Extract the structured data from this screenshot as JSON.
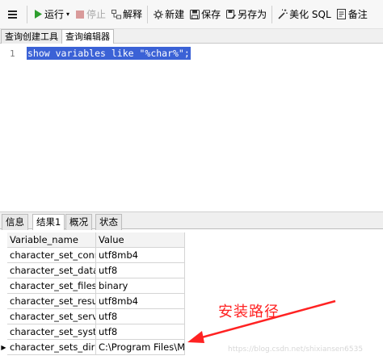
{
  "toolbar": {
    "menu_icon": "hamburger-icon",
    "run_label": "运行",
    "stop_label": "停止",
    "explain_label": "解释",
    "new_label": "新建",
    "save_label": "保存",
    "save_as_label": "另存为",
    "beautify_label": "美化 SQL",
    "notes_label": "备注"
  },
  "editor_tabs": [
    "查询创建工具",
    "查询编辑器"
  ],
  "editor": {
    "line_number": "1",
    "code": "show variables like \"%char%\";"
  },
  "result_tabs": [
    "信息",
    "结果1",
    "概况",
    "状态"
  ],
  "grid": {
    "columns": [
      "Variable_name",
      "Value"
    ],
    "rows": [
      [
        "character_set_conne",
        "utf8mb4"
      ],
      [
        "character_set_databa",
        "utf8"
      ],
      [
        "character_set_filesys",
        "binary"
      ],
      [
        "character_set_results",
        "utf8mb4"
      ],
      [
        "character_set_server",
        "utf8"
      ],
      [
        "character_set_system",
        "utf8"
      ],
      [
        "character_sets_dir",
        "C:\\Program Files\\My"
      ]
    ]
  },
  "annotation": {
    "text": "安装路径",
    "color": "#ff2222"
  },
  "watermark": "https://blog.csdn.net/shixiansen6535",
  "colors": {
    "selection": "#3b62d6",
    "run_icon": "#2e9e2e",
    "stop_icon": "#d99a9a"
  }
}
